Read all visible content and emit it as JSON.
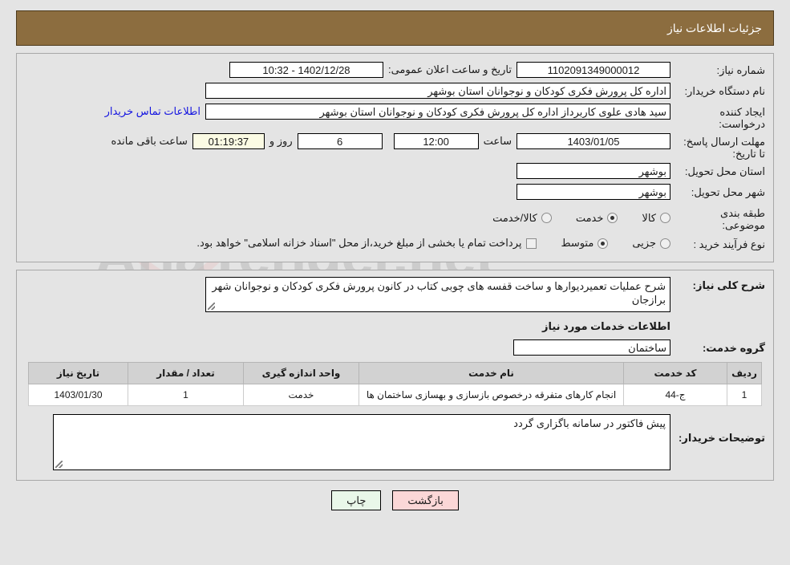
{
  "header": {
    "title": "جزئیات اطلاعات نیاز"
  },
  "top_form": {
    "need_number_label": "شماره نیاز:",
    "need_number_value": "1102091349000012",
    "announce_label": "تاریخ و ساعت اعلان عمومی:",
    "announce_value": "1402/12/28 - 10:32",
    "buyer_org_label": "نام دستگاه خریدار:",
    "buyer_org_value": "اداره کل پرورش فکری کودکان و نوجوانان استان بوشهر",
    "creator_label": "ایجاد کننده درخواست:",
    "creator_value": "سید هادی علوی کاربرداز اداره کل پرورش فکری کودکان و نوجوانان استان بوشهر",
    "contact_link": "اطلاعات تماس خریدار",
    "deadline_label": "مهلت ارسال پاسخ: تا تاریخ:",
    "deadline_date": "1403/01/05",
    "hour_label": "ساعت",
    "hour_value": "12:00",
    "days_value": "6",
    "days_sep_label": "روز و",
    "countdown_value": "01:19:37",
    "remaining_label": "ساعت باقی مانده",
    "province_label": "استان محل تحویل:",
    "province_value": "بوشهر",
    "city_label": "شهر محل تحویل:",
    "city_value": "بوشهر",
    "category_label": "طبقه بندی موضوعی:",
    "category_options": [
      {
        "label": "کالا",
        "selected": false
      },
      {
        "label": "خدمت",
        "selected": true
      },
      {
        "label": "کالا/خدمت",
        "selected": false
      }
    ],
    "process_label": "نوع فرآیند خرید :",
    "process_options": [
      {
        "label": "جزیی",
        "selected": false
      },
      {
        "label": "متوسط",
        "selected": true
      }
    ],
    "treasury_checkbox_checked": false,
    "treasury_note": "پرداخت تمام یا بخشی از مبلغ خرید،از محل \"اسناد خزانه اسلامی\" خواهد بود."
  },
  "detail": {
    "general_desc_label": "شرح کلی نیاز:",
    "general_desc_value": "شرح عملیات تعمیردیوارها و ساخت قفسه های چوبی کتاب در کانون پرورش فکری کودکان و نوجوانان شهر برازجان",
    "services_section_title": "اطلاعات خدمات مورد نیاز",
    "service_group_label": "گروه خدمت:",
    "service_group_value": "ساختمان",
    "table": {
      "headers": [
        "ردیف",
        "کد خدمت",
        "نام خدمت",
        "واحد اندازه گیری",
        "تعداد / مقدار",
        "تاریخ نیاز"
      ],
      "rows": [
        {
          "radif": "1",
          "code": "ج-44",
          "name": "انجام کارهای متفرقه درخصوص بازسازی و بهسازی ساختمان ها",
          "unit": "خدمت",
          "qty": "1",
          "date": "1403/01/30"
        }
      ]
    },
    "buyer_notes_label": "توضیحات خریدار:",
    "buyer_notes_value": "پیش فاکتور در سامانه باگزاری گردد"
  },
  "buttons": {
    "print": "چاپ",
    "back": "بازگشت"
  },
  "watermark": {
    "text": "AriaTender.net"
  },
  "colors": {
    "header_bar": "#8c6d3f",
    "page_bg": "#e4e4e4",
    "table_header": "#d2d2d2",
    "link": "#1414e0",
    "print_btn": "#e9f7e9",
    "back_btn": "#fbd7d7",
    "countdown_bg": "#fbfbe4"
  }
}
